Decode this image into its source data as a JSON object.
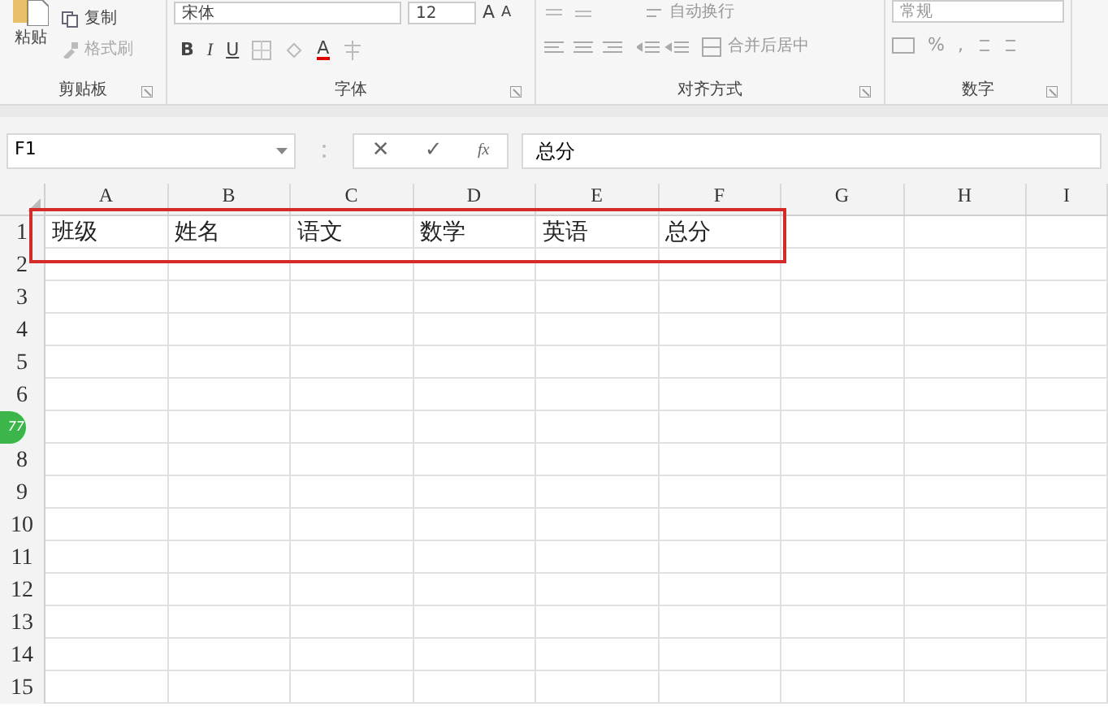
{
  "ribbon": {
    "clipboard": {
      "paste": "粘贴",
      "copy": "复制",
      "format_painter": "格式刷",
      "label": "剪贴板"
    },
    "font": {
      "font_name": "宋体",
      "font_size": "12",
      "grow_font": "A",
      "shrink_font": "A",
      "bold": "B",
      "italic": "I",
      "underline": "U",
      "font_color": "A",
      "label": "字体"
    },
    "alignment": {
      "wrap_text": "自动换行",
      "merge_center": "合并后居中",
      "label": "对齐方式"
    },
    "number": {
      "format": "常规",
      "percent": "%",
      "comma": ",",
      "label": "数字"
    }
  },
  "formula_bar": {
    "name_box": "F1",
    "cancel": "✕",
    "enter": "✓",
    "function": "fx",
    "value": "总分"
  },
  "columns": [
    "A",
    "B",
    "C",
    "D",
    "E",
    "F",
    "G",
    "H",
    "I"
  ],
  "rows": [
    {
      "number": "1",
      "cells": [
        "班级",
        "姓名",
        "语文",
        "数学",
        "英语",
        "总分"
      ]
    },
    {
      "number": "2"
    },
    {
      "number": "3"
    },
    {
      "number": "4"
    },
    {
      "number": "5"
    },
    {
      "number": "6"
    },
    {},
    {
      "number": "8"
    },
    {
      "number": "9"
    },
    {
      "number": "10"
    },
    {
      "number": "11"
    },
    {
      "number": "12"
    },
    {
      "number": "13"
    },
    {
      "number": "14"
    },
    {
      "number": "15"
    }
  ],
  "floating_badge": {
    "text": "77"
  }
}
